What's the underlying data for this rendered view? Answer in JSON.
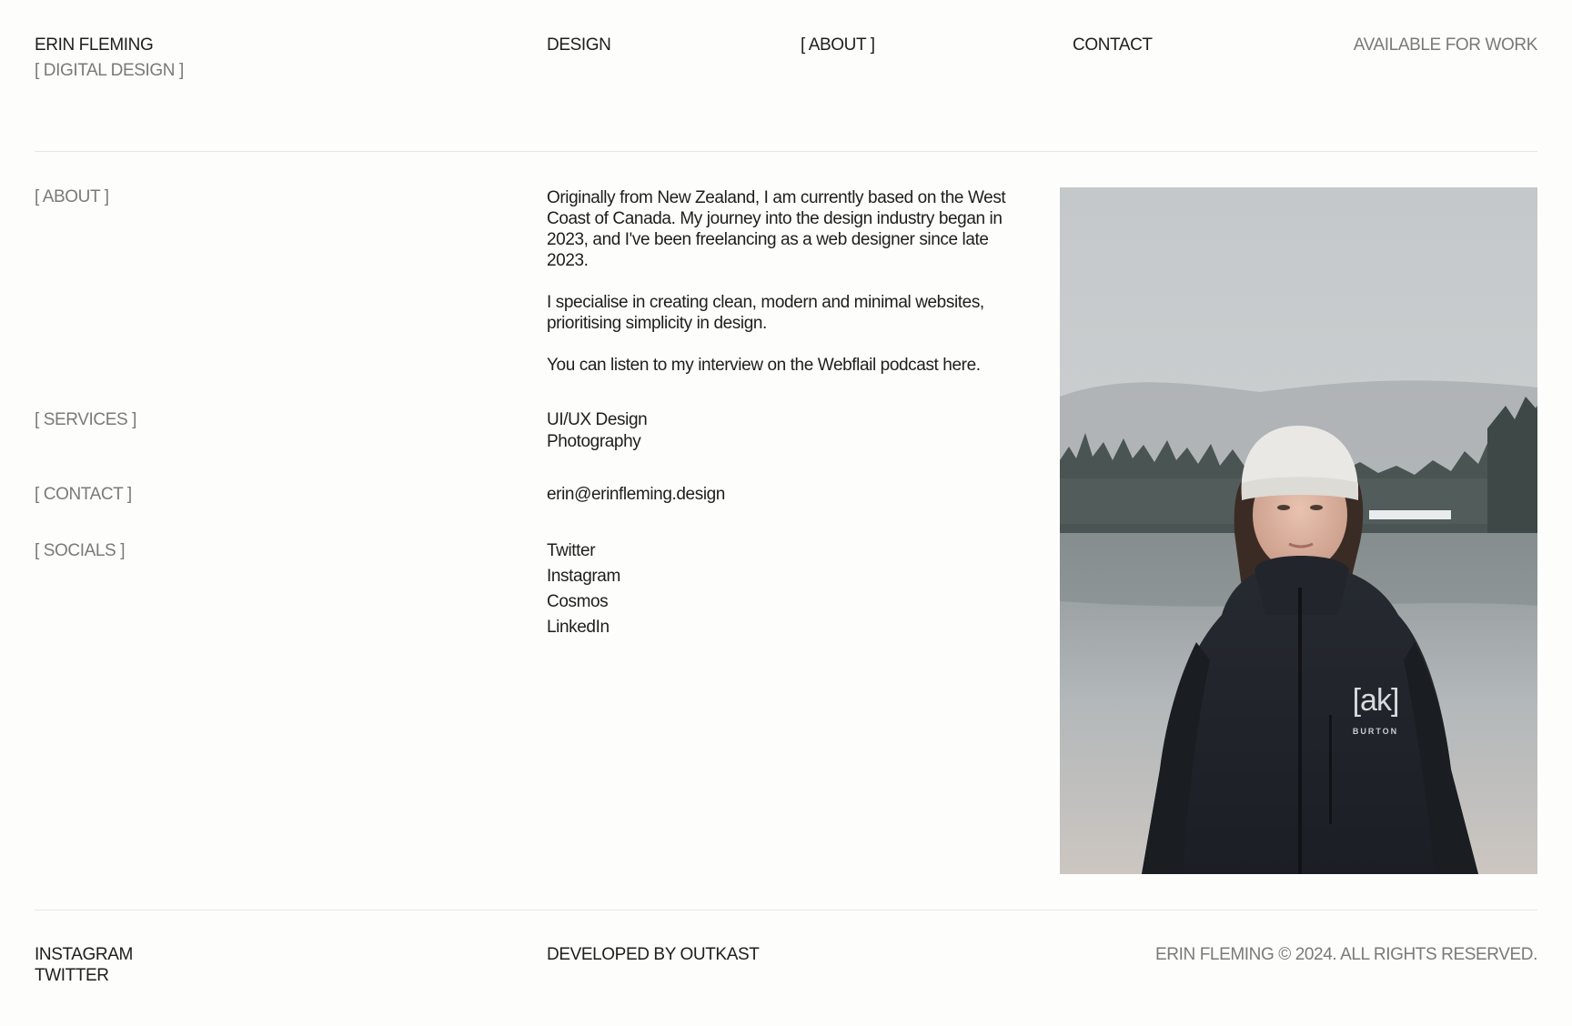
{
  "header": {
    "name": "ERIN FLEMING",
    "tagline": "[ DIGITAL DESIGN ]",
    "nav": {
      "design": "DESIGN",
      "about": "[ ABOUT ]",
      "contact": "CONTACT"
    },
    "availability": "AVAILABLE FOR WORK"
  },
  "about": {
    "label": "[ ABOUT ]",
    "paragraphs": [
      "Originally from New Zealand, I am currently based on the West Coast of Canada. My journey into the design industry began in 2023, and I've been freelancing as a web designer since late 2023.",
      "I specialise in creating clean, modern and minimal websites, prioritising simplicity in design.",
      "You can listen to my interview on the Webflail podcast here."
    ]
  },
  "services": {
    "label": "[ SERVICES ]",
    "items": [
      "UI/UX Design",
      "Photography"
    ]
  },
  "contact": {
    "label": "[ CONTACT ]",
    "email": "erin@erinfleming.design"
  },
  "socials": {
    "label": "[ SOCIALS ]",
    "items": [
      "Twitter",
      "Instagram",
      "Cosmos",
      "LinkedIn"
    ]
  },
  "photo": {
    "jacket_logo": "[ak]",
    "jacket_brand": "BURTON"
  },
  "footer": {
    "links": [
      "INSTAGRAM",
      "TWITTER"
    ],
    "developer": "DEVELOPED BY OUTKAST",
    "copyright": "ERIN FLEMING © 2024. ALL RIGHTS RESERVED."
  },
  "colors": {
    "background": "#fdfdfb",
    "text": "#1e1e1e",
    "muted": "#7a7a7a",
    "divider": "#e6e6e3"
  }
}
